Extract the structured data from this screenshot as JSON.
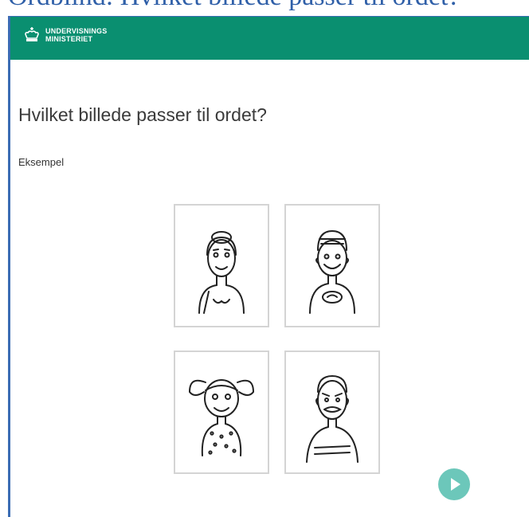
{
  "caption": "Ordblind: Hvilket billede passer til ordet?",
  "header": {
    "logo_line1": "UNDERVISNINGS",
    "logo_line2": "MINISTERIET",
    "bg_color": "#0a8f70"
  },
  "question": {
    "title": "Hvilket billede passer til ordet?",
    "label": "Eksempel"
  },
  "options": [
    {
      "icon": "woman-portrait"
    },
    {
      "icon": "boy-portrait"
    },
    {
      "icon": "girl-portrait"
    },
    {
      "icon": "old-man-portrait"
    }
  ],
  "next_button": {
    "icon": "play-icon",
    "color": "#6cc7ba"
  }
}
